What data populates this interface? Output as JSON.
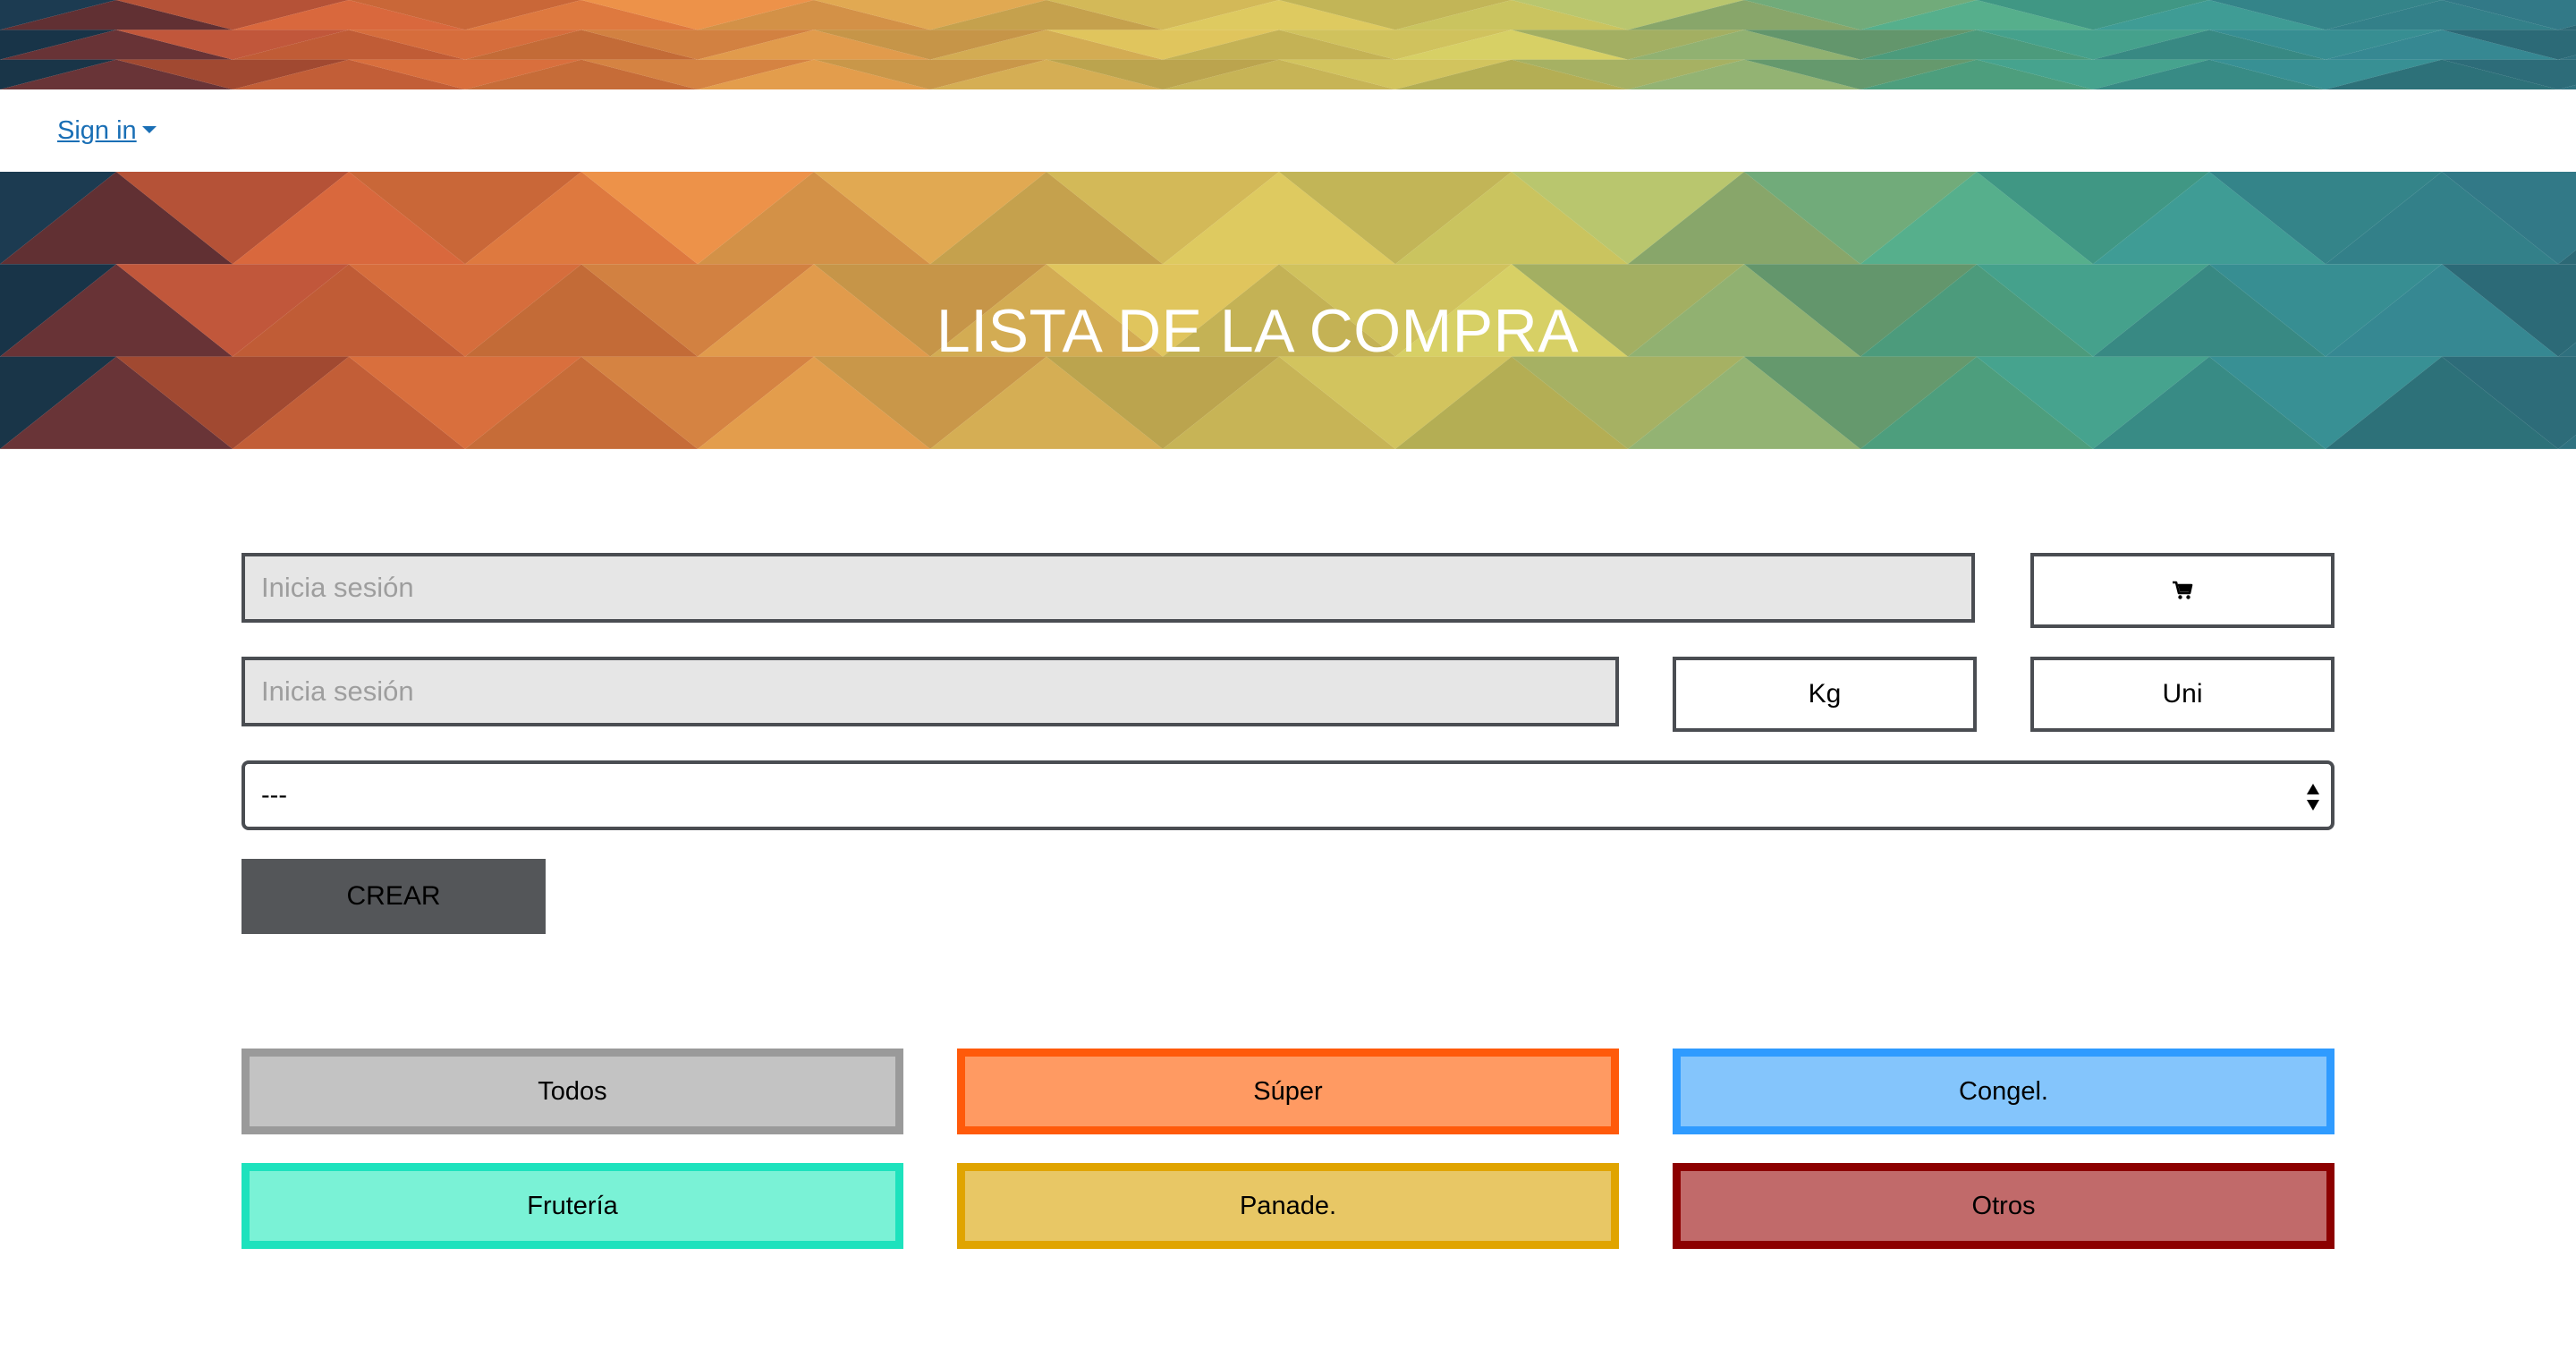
{
  "navbar": {
    "signin_label": "Sign in"
  },
  "hero": {
    "title": "LISTA DE LA COMPRA"
  },
  "form": {
    "name_placeholder": "Inicia sesión",
    "quantity_placeholder": "Inicia sesión",
    "cart_icon": "cart-icon",
    "kg_label": "Kg",
    "uni_label": "Uni",
    "select_value": "---",
    "create_label": "CREAR"
  },
  "filters": [
    {
      "label": "Todos",
      "border": "#9a9a9a",
      "fill": "#c3c3c3"
    },
    {
      "label": "Súper",
      "border": "#ff5a0a",
      "fill": "#ff9a62"
    },
    {
      "label": "Congel.",
      "border": "#2f9bff",
      "fill": "#84c5fc"
    },
    {
      "label": "Frutería",
      "border": "#1de2bd",
      "fill": "#7af2d6"
    },
    {
      "label": "Panade.",
      "border": "#e0a400",
      "fill": "#e8c765"
    },
    {
      "label": "Otros",
      "border": "#8c0000",
      "fill": "#c16a6a"
    }
  ],
  "colors": {
    "link": "#1a6fb5",
    "create_button": "#545659",
    "field_border": "#4a4d52",
    "field_fill": "#e6e6e6"
  }
}
